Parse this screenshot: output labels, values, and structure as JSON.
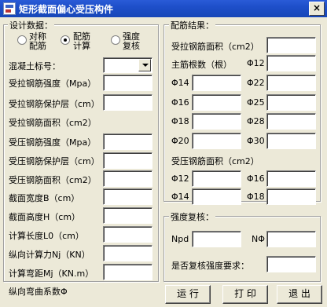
{
  "window": {
    "title": "矩形截面偏心受压构件",
    "close_glyph": "×"
  },
  "design": {
    "caption": "设计数据：",
    "radios": [
      {
        "label": "对称配筋",
        "selected": false
      },
      {
        "label": "配筋计算",
        "selected": true
      },
      {
        "label": "强度复核",
        "selected": false
      }
    ],
    "concrete_label": "混凝土标号：",
    "fields": [
      {
        "label": "受拉钢筋强度（Mpa）",
        "value": ""
      },
      {
        "label": "受拉钢筋保护层（cm）",
        "value": ""
      },
      {
        "label": "受拉钢筋面积（cm2）",
        "value": null
      },
      {
        "label": "受压钢筋强度（Mpa）",
        "value": ""
      },
      {
        "label": "受压钢筋保护层（cm）",
        "value": ""
      },
      {
        "label": "受压钢筋面积（cm2）",
        "value": ""
      },
      {
        "label": "截面宽度B（cm）",
        "value": ""
      },
      {
        "label": "截面高度H（cm）",
        "value": ""
      },
      {
        "label": "计算长度L0（cm）",
        "value": ""
      },
      {
        "label": "纵向计算力Nj（KN）",
        "value": ""
      },
      {
        "label": "计算弯距Mj（KN.m）",
        "value": ""
      },
      {
        "label": "纵向弯曲系数Φ",
        "value": null
      }
    ]
  },
  "result": {
    "caption": "配筋结果：",
    "tension_area_label": "受拉钢筋面积（cm2）",
    "bar_count_label": "主筋根数（根）",
    "tension_bars": [
      "Φ12",
      "Φ14",
      "Φ22",
      "Φ16",
      "Φ25",
      "Φ18",
      "Φ28",
      "Φ20",
      "Φ30"
    ],
    "compression_area_label": "受压钢筋面积（cm2）",
    "compression_bars": [
      "Φ12",
      "Φ16",
      "Φ14",
      "Φ18"
    ]
  },
  "check": {
    "caption": "强度复核：",
    "npd_label": "Npd",
    "nphi_label": "NΦ",
    "need_check_label": "是否复核强度要求："
  },
  "buttons": {
    "run": "运 行",
    "print": "打 印",
    "exit": "退 出"
  }
}
